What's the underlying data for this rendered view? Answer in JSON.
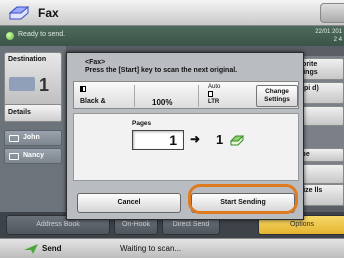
{
  "header": {
    "title": "Fax",
    "icon": "fax-icon"
  },
  "status": {
    "ready": "Ready to send.",
    "date": "22/01 201",
    "time": "2 4"
  },
  "background": {
    "destination_label": "Destination",
    "destination_count": "1",
    "details_label": "Details",
    "contacts": [
      "John",
      "Nancy"
    ],
    "right_buttons": [
      "Favorite Settings",
      "00 dpi d)",
      "ze",
      "l Type",
      "d ed",
      "nt Size lls"
    ],
    "bottom_buttons": [
      "Address Book",
      "On-Hook",
      "Direct Send",
      "Options"
    ]
  },
  "modal": {
    "title": "<Fax>",
    "message": "Press the [Start] key to scan the next original.",
    "color_mode": "Black &",
    "ratio": "100%",
    "paper_auto": "Auto",
    "paper_size": "LTR",
    "change_settings": "Change Settings",
    "pages_label": "Pages",
    "pages_scanned": "1",
    "pages_sent": "1",
    "cancel_label": "Cancel",
    "start_sending_label": "Start Sending"
  },
  "footer": {
    "send_label": "Send",
    "status": "Waiting to scan..."
  },
  "colors": {
    "highlight": "#e07a1e",
    "status_dot": "#5bb53a",
    "options_button": "#e5b430"
  }
}
